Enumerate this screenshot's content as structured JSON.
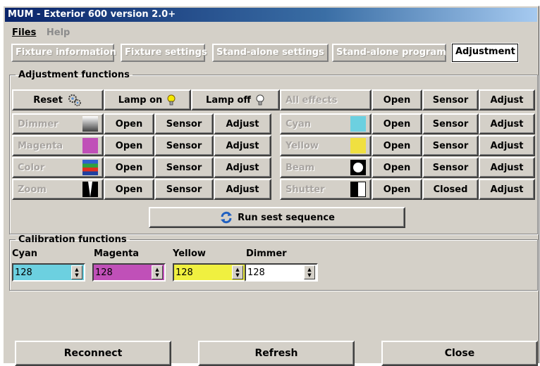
{
  "window": {
    "title": "MUM - Exterior 600 version 2.0+"
  },
  "menu": {
    "files": "Files",
    "help": "Help"
  },
  "tabs": [
    {
      "label": "Fixture information",
      "active": false
    },
    {
      "label": "Fixture settings",
      "active": false
    },
    {
      "label": "Stand-alone settings",
      "active": false
    },
    {
      "label": "Stand-alone program",
      "active": false
    },
    {
      "label": "Adjustment",
      "active": true
    }
  ],
  "adjustment": {
    "legend": "Adjustment functions",
    "reset": "Reset",
    "lamp_on": "Lamp on",
    "lamp_off": "Lamp off",
    "all_effects": "All effects",
    "open": "Open",
    "sensor": "Sensor",
    "adjust": "Adjust",
    "closed": "Closed",
    "left_rows": [
      {
        "name": "Dimmer",
        "c3": "Sensor",
        "swatch": "gradient-gray"
      },
      {
        "name": "Magenta",
        "c3": "Sensor",
        "swatch": "#c050b8"
      },
      {
        "name": "Color",
        "c3": "Sensor",
        "swatch": "color-wheel"
      },
      {
        "name": "Zoom",
        "c3": "Sensor",
        "swatch": "zoom"
      }
    ],
    "right_rows": [
      {
        "name": "Cyan",
        "c3": "Sensor",
        "swatch": "#6cd0e0"
      },
      {
        "name": "Yellow",
        "c3": "Sensor",
        "swatch": "#f0e040"
      },
      {
        "name": "Beam",
        "c3": "Sensor",
        "swatch": "beam"
      },
      {
        "name": "Shutter",
        "c3": "Closed",
        "swatch": "shutter"
      }
    ],
    "run_sequence": "Run sest sequence"
  },
  "calibration": {
    "legend": "Calibration functions",
    "fields": [
      {
        "label": "Cyan",
        "value": "128",
        "color": "#6cd0e0"
      },
      {
        "label": "Magenta",
        "value": "128",
        "color": "#c050b8"
      },
      {
        "label": "Yellow",
        "value": "128",
        "color": "#f0f040"
      },
      {
        "label": "Dimmer",
        "value": "128",
        "color": "#ffffff"
      }
    ]
  },
  "footer": {
    "reconnect": "Reconnect",
    "refresh": "Refresh",
    "close": "Close"
  }
}
